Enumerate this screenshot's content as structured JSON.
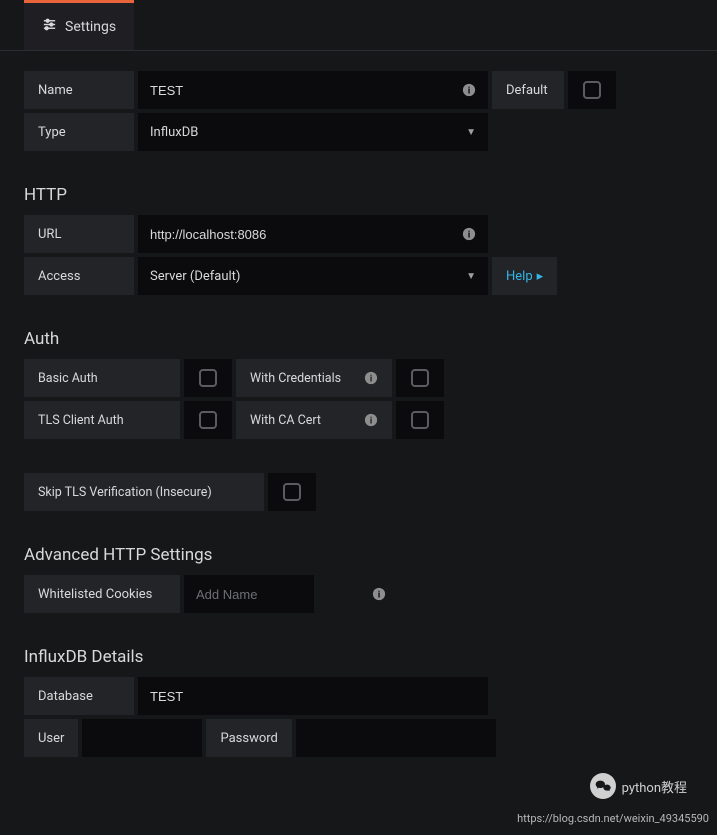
{
  "tab": {
    "label": "Settings"
  },
  "basic": {
    "name_label": "Name",
    "name_value": "TEST",
    "default_label": "Default",
    "type_label": "Type",
    "type_value": "InfluxDB"
  },
  "http": {
    "heading": "HTTP",
    "url_label": "URL",
    "url_value": "http://localhost:8086",
    "access_label": "Access",
    "access_value": "Server (Default)",
    "help_label": "Help"
  },
  "auth": {
    "heading": "Auth",
    "basic_auth": "Basic Auth",
    "with_credentials": "With Credentials",
    "tls_client": "TLS Client Auth",
    "with_ca_cert": "With CA Cert",
    "skip_tls": "Skip TLS Verification (Insecure)"
  },
  "advanced": {
    "heading": "Advanced HTTP Settings",
    "whitelisted_label": "Whitelisted Cookies",
    "addname_placeholder": "Add Name"
  },
  "influx": {
    "heading": "InfluxDB Details",
    "database_label": "Database",
    "database_value": "TEST",
    "user_label": "User",
    "password_label": "Password"
  },
  "watermark": {
    "brand": "python教程",
    "url": "https://blog.csdn.net/weixin_49345590"
  }
}
